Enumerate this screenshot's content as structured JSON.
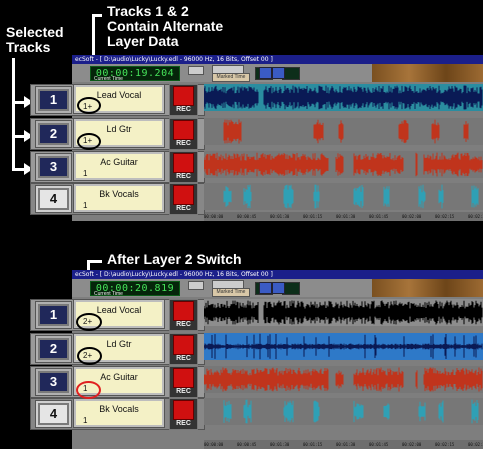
{
  "callouts": {
    "selected_tracks": "Selected\nTracks",
    "top": "Tracks 1 & 2\nContain Alternate\nLayer Data",
    "bottom": "After Layer 2 Switch"
  },
  "window": {
    "title_top": "ecSoft - [ D:\\audio\\Lucky\\Lucky.edl - 96000 Hz, 16 Bits, Offset 00 ]",
    "title_bottom": "ecSoft - [ D:\\audio\\Lucky\\Lucky.edl - 96000 Hz, 16 Bits, Offset 00 ]",
    "counter_top": "00:00:19.204",
    "counter_bottom": "00:00:20.819",
    "counter_label": "Current Time",
    "marked_time": "Marked Time",
    "timeline_labels": [
      "00:00:00",
      "00:00:45",
      "00:01:30",
      "00:01:15",
      "00:01:30",
      "00:01:45",
      "00:02:00",
      "00:02:15",
      "00:02:30"
    ]
  },
  "rec_label": "REC",
  "top_tracks": [
    {
      "number": "1",
      "name": "Lead Vocal",
      "layer": "1+",
      "selected": true
    },
    {
      "number": "2",
      "name": "Ld Gtr",
      "layer": "1+",
      "selected": true
    },
    {
      "number": "3",
      "name": "Ac Guitar",
      "layer": "1",
      "selected": true
    },
    {
      "number": "4",
      "name": "Bk Vocals",
      "layer": "1",
      "selected": false
    }
  ],
  "bottom_tracks": [
    {
      "number": "1",
      "name": "Lead Vocal",
      "layer": "2+",
      "selected": true
    },
    {
      "number": "2",
      "name": "Ld Gtr",
      "layer": "2+",
      "selected": true
    },
    {
      "number": "3",
      "name": "Ac Guitar",
      "layer": "1",
      "selected": true
    },
    {
      "number": "4",
      "name": "Bk Vocals",
      "layer": "1",
      "selected": false
    }
  ],
  "colors": {
    "vocal_wave": "#0a1a55",
    "vocal_wave_after": "#000000",
    "guitar_wave": "#c0341c",
    "bk_wave": "#2fa0b5",
    "highlight_ellipse": "#e02020"
  }
}
